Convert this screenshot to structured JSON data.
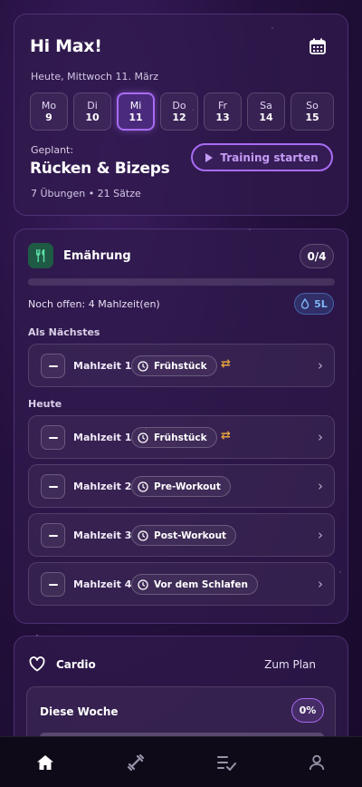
{
  "header": {
    "greeting": "Hi Max!",
    "date_line": "Heute, Mittwoch 11. März"
  },
  "week_days": [
    {
      "name": "Mo",
      "num": "9",
      "active": false
    },
    {
      "name": "Di",
      "num": "10",
      "active": false
    },
    {
      "name": "Mi",
      "num": "11",
      "active": true
    },
    {
      "name": "Do",
      "num": "12",
      "active": false
    },
    {
      "name": "Fr",
      "num": "13",
      "active": false
    },
    {
      "name": "Sa",
      "num": "14",
      "active": false
    },
    {
      "name": "So",
      "num": "15",
      "active": false
    }
  ],
  "planned": {
    "label": "Geplant:",
    "title": "Rücken & Bizeps",
    "meta": "7 Übungen • 21 Sätze",
    "start_button": "Training starten"
  },
  "nutrition": {
    "title": "Emährung",
    "count": "0/4",
    "progress": 0,
    "open_text": "Noch offen: 4 Mahlzeit(en)",
    "water": "5L",
    "next_label": "Als Nächstes",
    "today_label": "Heute",
    "next_meal": {
      "name": "Mahlzeit 1",
      "tag": "Frühstück",
      "swap": true
    },
    "meals": [
      {
        "name": "Mahlzeit 1",
        "tag": "Frühstück",
        "swap": true
      },
      {
        "name": "Mahlzeit 2",
        "tag": "Pre-Workout",
        "swap": false
      },
      {
        "name": "Mahlzeit 3",
        "tag": "Post-Workout",
        "swap": false
      },
      {
        "name": "Mahlzeit 4",
        "tag": "Vor dem Schlafen",
        "swap": false
      }
    ]
  },
  "cardio": {
    "title": "Cardio",
    "to_plan": "Zum Plan",
    "week_title": "Diese Woche",
    "percent": "0%",
    "progress": 0
  },
  "nav": {
    "items": [
      "home-icon",
      "dumbbell-icon",
      "checklist-icon",
      "profile-icon"
    ],
    "active": "home-icon"
  },
  "colors": {
    "accent": "#a86cf2",
    "swap": "#e6a23c",
    "water": "#7fb5f5",
    "nutrition_icon_bg": "#1f5a45"
  }
}
